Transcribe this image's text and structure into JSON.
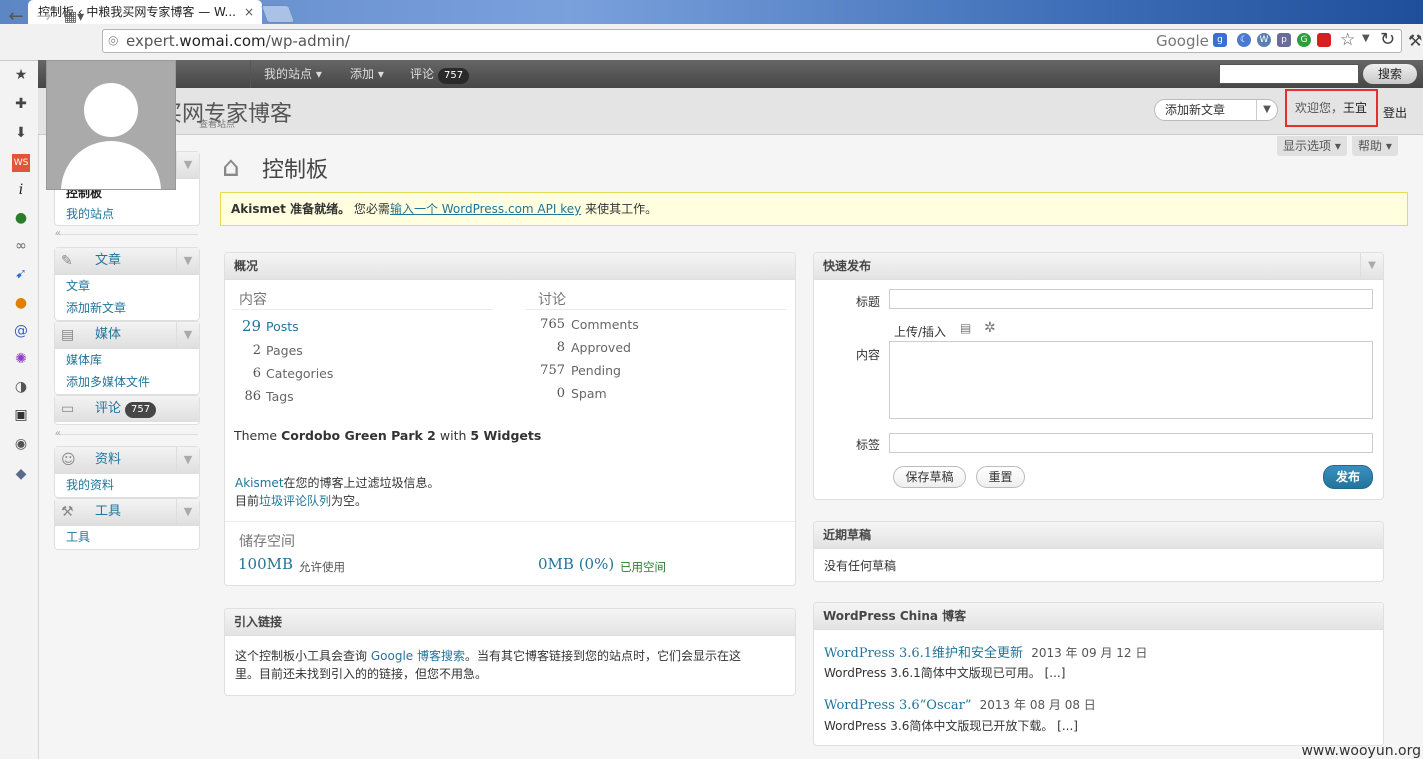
{
  "browser": {
    "tab_title": "控制板 ‹ 中粮我买网专家博客 — W...",
    "tab_close": "×",
    "url_host_prefix": "expert.",
    "url_host_main": "womai.com",
    "url_path": "/wp-admin/",
    "search_engine": "Google"
  },
  "adminbar": {
    "my_sites": "我的站点 ▾",
    "add": "添加 ▾",
    "comments": "评论",
    "comment_count": "757",
    "search_button": "搜索"
  },
  "header": {
    "site_title": "买网专家博客",
    "site_sub": "查看站点",
    "favorite_action": "添加新文章",
    "welcome": "欢迎您，",
    "user_name": "王宜",
    "logout": "登出",
    "screen_options": "显示选项 ▾",
    "help": "帮助 ▾"
  },
  "menu": {
    "dashboard": "控制板",
    "my_sites": "我的站点",
    "posts": "文章",
    "posts_sub": [
      "文章",
      "添加新文章"
    ],
    "media": "媒体",
    "media_sub": [
      "媒体库",
      "添加多媒体文件"
    ],
    "comments": "评论",
    "comments_count": "757",
    "profile": "资料",
    "profile_sub": [
      "我的资料"
    ],
    "tools": "工具",
    "tools_sub": [
      "工具"
    ]
  },
  "page": {
    "title": "控制板"
  },
  "notice": {
    "bold": "Akismet 准备就绪。",
    "text1": "您必需",
    "link": "输入一个 WordPress.com API key",
    "text2": "来使其工作。"
  },
  "right_now": {
    "title": "概况",
    "content_head": "内容",
    "discussion_head": "讨论",
    "content": [
      {
        "num": "29",
        "label": "Posts"
      },
      {
        "num": "2",
        "label": "Pages"
      },
      {
        "num": "6",
        "label": "Categories"
      },
      {
        "num": "86",
        "label": "Tags"
      }
    ],
    "discussion": [
      {
        "num": "765",
        "label": "Comments"
      },
      {
        "num": "8",
        "label": "Approved"
      },
      {
        "num": "757",
        "label": "Pending"
      },
      {
        "num": "0",
        "label": "Spam"
      }
    ],
    "theme_prefix": "Theme",
    "theme_name": "Cordobo Green Park 2",
    "theme_with": "with",
    "theme_widgets": "5 Widgets",
    "akismet_link": "Akismet",
    "akismet_text": "在您的博客上过滤垃圾信息。",
    "spam_prefix": "目前",
    "spam_link": "垃圾评论队列",
    "spam_suffix": "为空。",
    "storage_head": "储存空间",
    "storage_total": "100MB",
    "storage_total_label": "允许使用",
    "storage_used": "0MB (0%)",
    "storage_used_label": "已用空间"
  },
  "incoming": {
    "title": "引入链接",
    "text1": "这个控制板小工具会查询",
    "link": "Google 博客搜索",
    "text2": "。当有其它博客链接到您的站点时，它们会显示在这",
    "text3": "里。目前还未找到引入的的链接，但您不用急。"
  },
  "quick_press": {
    "title": "快速发布",
    "title_label": "标题",
    "upload_label": "上传/插入",
    "content_label": "内容",
    "tags_label": "标签",
    "save_draft": "保存草稿",
    "reset": "重置",
    "publish": "发布"
  },
  "recent_drafts": {
    "title": "近期草稿",
    "empty": "没有任何草稿"
  },
  "wp_china": {
    "title": "WordPress China 博客",
    "items": [
      {
        "link": "WordPress 3.6.1维护和安全更新",
        "date": "2013 年 09 月 12 日",
        "desc": "WordPress 3.6.1简体中文版现已可用。 [...]"
      },
      {
        "link": "WordPress 3.6“Oscar”",
        "date": "2013 年 08 月 08 日",
        "desc": "WordPress 3.6简体中文版现已开放下载。 [...]"
      }
    ]
  },
  "watermark": "www.wooyun.org",
  "colors": {
    "link": "#21759b",
    "publish": "#21759b",
    "highlight_border": "#e0312f"
  }
}
